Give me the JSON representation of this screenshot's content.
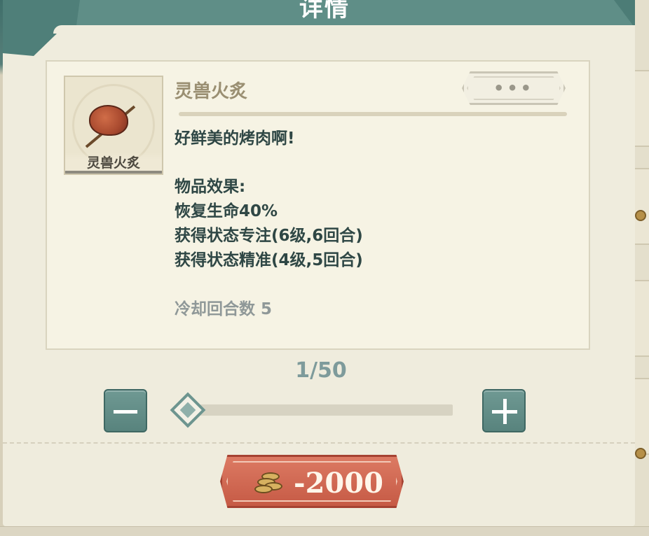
{
  "dialog": {
    "title": "详情"
  },
  "item": {
    "name": "灵兽火炙",
    "thumb_label": "灵兽火炙",
    "description": "好鲜美的烤肉啊!",
    "effects_heading": "物品效果:",
    "effects": [
      "恢复生命40%",
      "获得状态专注(6级,6回合)",
      "获得状态精准(4级,5回合)"
    ],
    "cooldown": "冷却回合数 5",
    "more_label": "•••"
  },
  "quantity": {
    "readout": "1/50",
    "current": 1,
    "max": 50
  },
  "cost": {
    "value": "-2000",
    "icon": "coin-stack-icon"
  },
  "colors": {
    "header": "#5f8e87",
    "panel": "#efecdd",
    "text": "#2f4745",
    "accent_button": "#c65a45"
  }
}
